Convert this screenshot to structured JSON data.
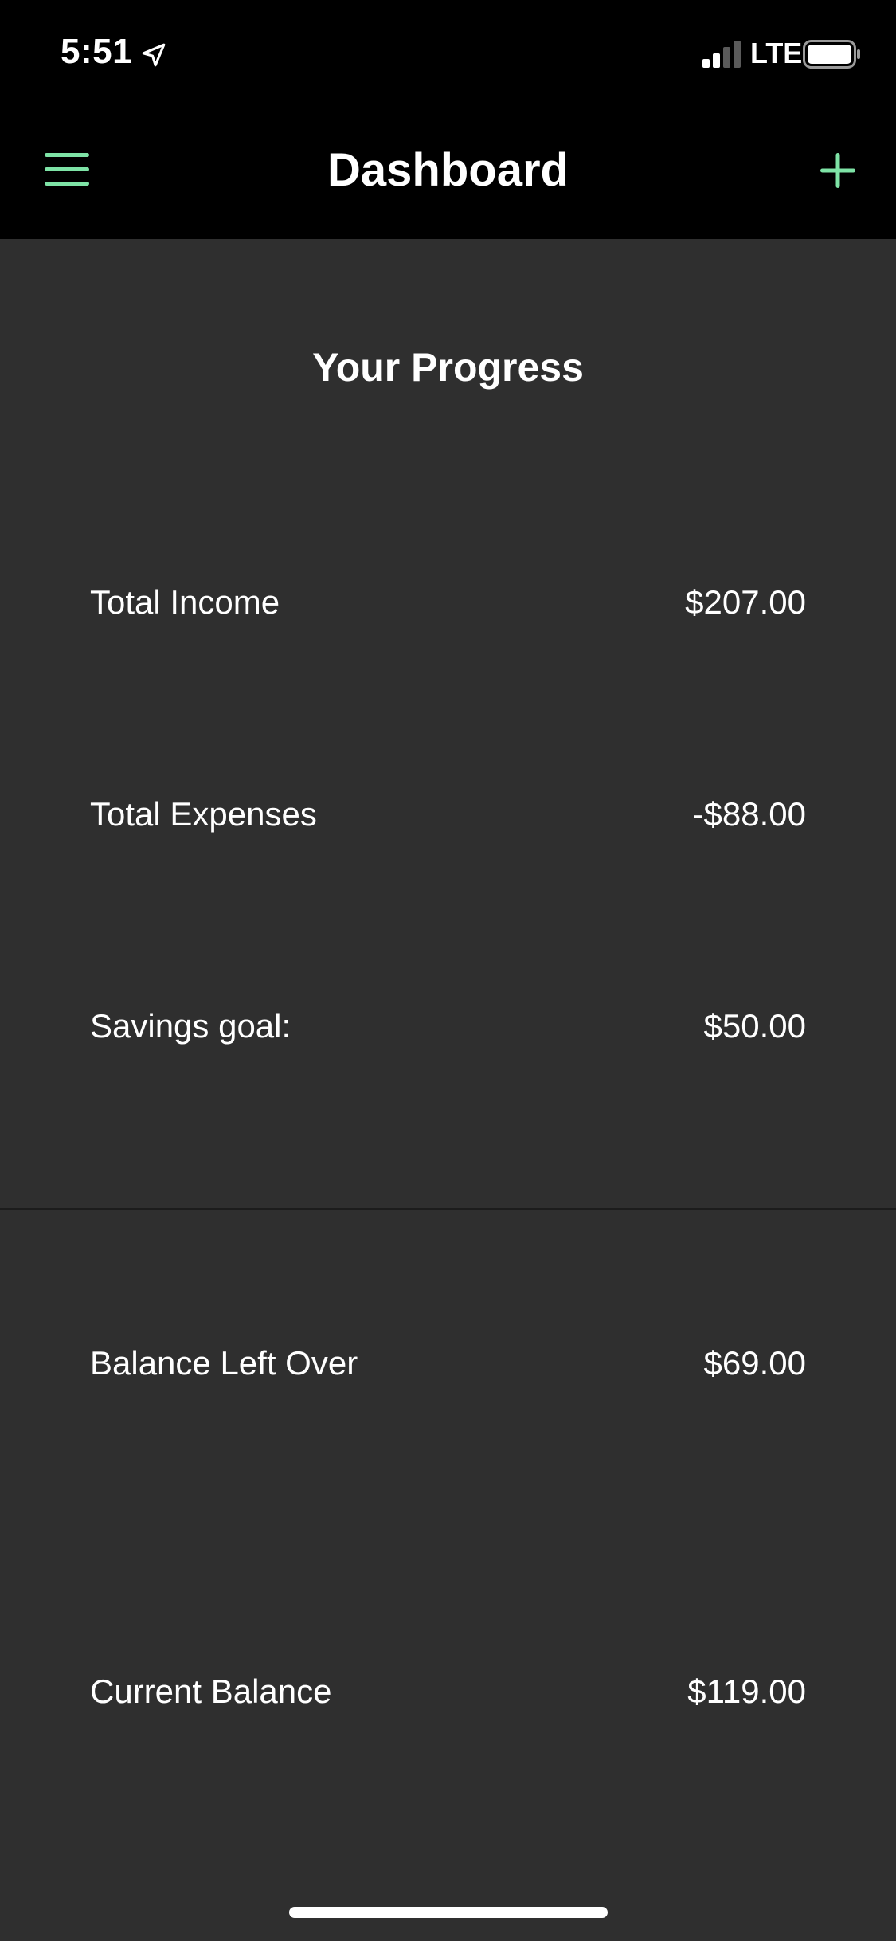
{
  "status_bar": {
    "time": "5:51",
    "network": "LTE",
    "icons": {
      "location": "location-arrow-icon",
      "signal": "cellular-signal-icon",
      "battery": "battery-icon"
    }
  },
  "nav": {
    "title": "Dashboard",
    "menu_icon": "hamburger-menu-icon",
    "add_icon": "plus-icon",
    "accent_color": "#7ee3a6"
  },
  "progress": {
    "title": "Your Progress",
    "rows": [
      {
        "label": "Total Income",
        "value": "$207.00"
      },
      {
        "label": "Total Expenses",
        "value": "-$88.00"
      },
      {
        "label": "Savings goal:",
        "value": "$50.00"
      }
    ]
  },
  "balances": {
    "rows": [
      {
        "label": "Balance Left Over",
        "value": "$69.00"
      },
      {
        "label": "Current Balance",
        "value": "$119.00"
      }
    ]
  },
  "colors": {
    "background": "#2f2f2f",
    "bar_background": "#000000",
    "text": "#ffffff",
    "accent": "#7ee3a6"
  }
}
